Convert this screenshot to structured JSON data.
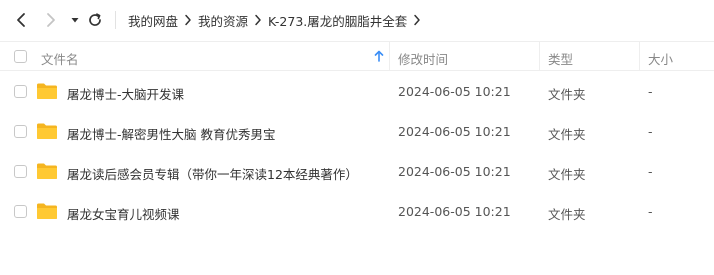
{
  "breadcrumb": [
    "我的网盘",
    "我的资源",
    "K-273.屠龙的胭脂井全套"
  ],
  "columns": {
    "name": "文件名",
    "modified": "修改时间",
    "type": "类型",
    "size": "大小"
  },
  "sort": {
    "column": "name",
    "direction": "ascending",
    "icon": "arrow-up-icon"
  },
  "files": [
    {
      "name": "屠龙博士-大脑开发课",
      "modified": "2024-06-05 10:21",
      "type": "文件夹",
      "size": "-"
    },
    {
      "name": "屠龙博士-解密男性大脑 教育优秀男宝",
      "modified": "2024-06-05 10:21",
      "type": "文件夹",
      "size": "-"
    },
    {
      "name": "屠龙读后感会员专辑（带你一年深读12本经典著作）",
      "modified": "2024-06-05 10:21",
      "type": "文件夹",
      "size": "-"
    },
    {
      "name": "屠龙女宝育儿视频课",
      "modified": "2024-06-05 10:21",
      "type": "文件夹",
      "size": "-"
    }
  ],
  "colors": {
    "folder": "#ffc933",
    "folder_dark": "#f5b520",
    "sort_arrow": "#3a8ef6",
    "disabled_icon": "#c4c4c4"
  }
}
